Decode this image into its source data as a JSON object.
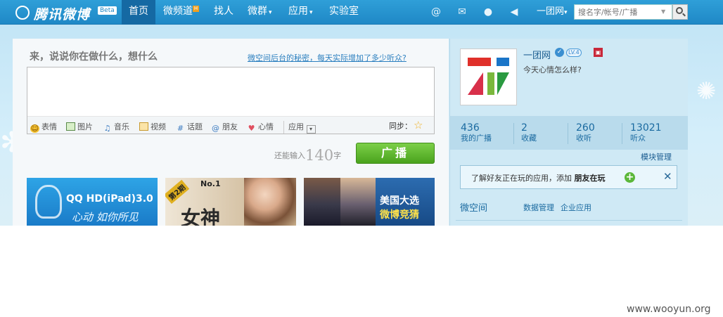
{
  "logo": {
    "name": "腾讯微博",
    "badge": "Beta"
  },
  "nav": {
    "home": "首页",
    "channel": "微频道",
    "channel_badge": "H",
    "find_people": "找人",
    "groups": "微群",
    "apps": "应用",
    "lab": "实验室",
    "caret": "▾"
  },
  "top_icons": [
    "at-icon",
    "mail-icon",
    "person-icon",
    "speaker-icon"
  ],
  "account": {
    "label": "一团网",
    "caret": "▾"
  },
  "search": {
    "placeholder": "搜名字/帐号/广播"
  },
  "publisher": {
    "prompt": "来，说说你在做什么，想什么",
    "promo_link": "微空间后台的秘密，每天实际增加了多少听众?",
    "tools": [
      "表情",
      "图片",
      "音乐",
      "视频",
      "话题",
      "朋友",
      "心情",
      "应用"
    ],
    "sync_label": "同步：",
    "remaining_prefix": "还能输入",
    "remaining_count": "140",
    "remaining_suffix": "字",
    "post_button": "广播"
  },
  "banners": [
    {
      "line1": "QQ HD(iPad)3.0",
      "line2": "心动 如你所见"
    },
    {
      "episode": "第2期",
      "no": "No.1",
      "headline": "女神"
    },
    {
      "line1": "美国大选",
      "line2": "微博竞猜"
    }
  ],
  "profile": {
    "name": "一团网",
    "verified_icon": "verified-icon",
    "level": "LV.4",
    "mood_prompt": "今天心情怎么样?",
    "stats": [
      {
        "value": "436",
        "label": "我的广播"
      },
      {
        "value": "2",
        "label": "收藏"
      },
      {
        "value": "260",
        "label": "收听"
      },
      {
        "value": "13021",
        "label": "听众"
      }
    ],
    "module_manage": "模块管理",
    "notice_text": "了解好友正在玩的应用，添加",
    "notice_bold": "朋友在玩",
    "micro_space": "微空间",
    "data_manage": "数据管理",
    "enterprise_apps": "企业应用"
  },
  "colors": {
    "topbar": "#2f9fd8",
    "post_button": "#5cb82a",
    "link": "#2b7fbf"
  },
  "watermark": "www.wooyun.org"
}
